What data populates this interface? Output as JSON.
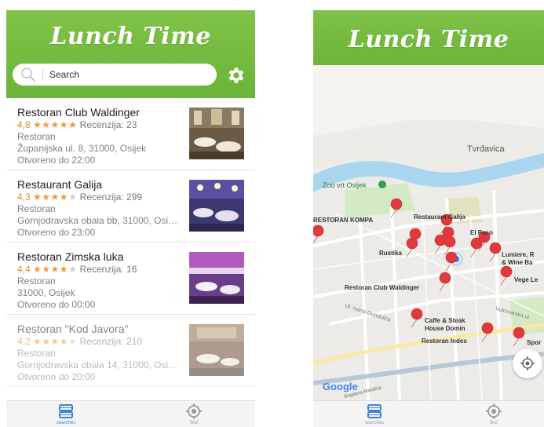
{
  "app": {
    "title": "Lunch Time"
  },
  "search": {
    "placeholder": "Search",
    "value": ""
  },
  "restaurants": [
    {
      "name": "Restoran Club Waldinger",
      "rating": "4,8",
      "stars_full": 5,
      "stars_half": 0,
      "reviews_label": "Recenzija: 23",
      "type": "Restoran",
      "address": "Županijska ul. 8, 31000, Osijek",
      "hours": "Otvoreno do 22:00"
    },
    {
      "name": "Restaurant Galija",
      "rating": "4,3",
      "stars_full": 4,
      "stars_half": 1,
      "reviews_label": "Recenzija: 299",
      "type": "Restoran",
      "address": "Gornjodravska obala bb, 31000, Osij…",
      "hours": "Otvoreno do 23:00"
    },
    {
      "name": "Restoran Zimska luka",
      "rating": "4,4",
      "stars_full": 4,
      "stars_half": 1,
      "reviews_label": "Recenzija: 16",
      "type": "Restoran",
      "address": "31000, Osijek",
      "hours": "Otvoreno do 00:00"
    },
    {
      "name": "Restoran \"Kod Javora\"",
      "rating": "4,2",
      "stars_full": 4,
      "stars_half": 0,
      "reviews_label": "Recenzija: 210",
      "type": "Restoran",
      "address": "Gornjodravska obala 14, 31000, Osij…",
      "hours": "Otvoreno do 20:00"
    }
  ],
  "tabs": [
    {
      "label": "searches",
      "icon": "list-icon",
      "active": true
    },
    {
      "label": "find",
      "icon": "target-icon",
      "active": false
    }
  ],
  "map": {
    "labels": {
      "tvrdavica": "Tvrđavica",
      "zoo": "Zoo vrt Osijek",
      "kompa": "RESTORAN KOMPA",
      "galija": "Restaurant Galija",
      "elpaso": "El Paso",
      "rustika": "Rustika",
      "lumiere1": "Lumiere, R",
      "lumiere2": "& Wine Ba",
      "vege": "Vege Le",
      "waldinger": "Restoran Club Waldinger",
      "gundulica": "Ul. Ivana Gundulića",
      "vukovarska": "Vukovarska ul",
      "caffe1": "Caffe & Steak",
      "caffe2": "House Domin",
      "index": "Restoran Index",
      "spor": "Spor",
      "mandica": "Bogdana Mandića",
      "google": "Google"
    }
  },
  "colors": {
    "brand": "#6cb43a",
    "star": "#f29a33",
    "pin": "#e0393e",
    "tab_active": "#3d85d6"
  }
}
